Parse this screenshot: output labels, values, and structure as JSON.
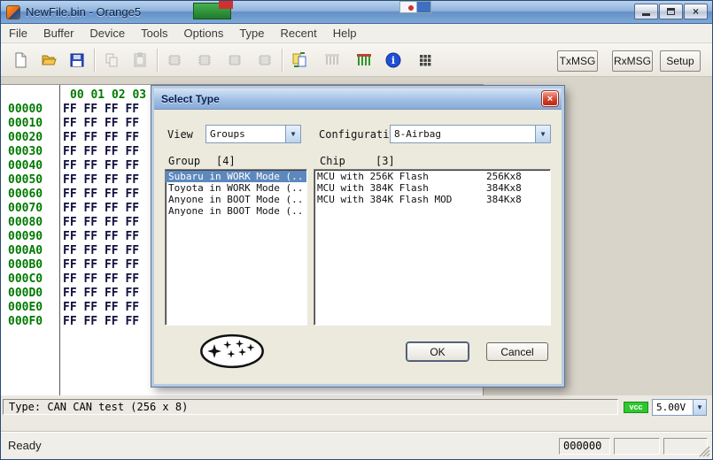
{
  "window": {
    "title": "NewFile.bin - Orange5"
  },
  "icons": {
    "close_glyph": "×",
    "dropdown_glyph": "▼"
  },
  "menu": {
    "items": [
      "File",
      "Buffer",
      "Device",
      "Tools",
      "Options",
      "Type",
      "Recent",
      "Help"
    ]
  },
  "toolbar": {
    "icon_buttons": [
      "new-file",
      "open-file",
      "save-file",
      "copy",
      "paste",
      "chip-1",
      "chip-2",
      "chip-3",
      "chip-4",
      "compare-buffers",
      "connector-inactive",
      "connector-active",
      "info",
      "keypad"
    ],
    "txmsg_label": "TxMSG",
    "rxmsg_label": "RxMSG",
    "setup_label": "Setup"
  },
  "hex": {
    "col_header": "00 01 02 03",
    "rows": [
      {
        "addr": "00000",
        "bytes": "FF FF FF FF"
      },
      {
        "addr": "00010",
        "bytes": "FF FF FF FF"
      },
      {
        "addr": "00020",
        "bytes": "FF FF FF FF"
      },
      {
        "addr": "00030",
        "bytes": "FF FF FF FF"
      },
      {
        "addr": "00040",
        "bytes": "FF FF FF FF"
      },
      {
        "addr": "00050",
        "bytes": "FF FF FF FF"
      },
      {
        "addr": "00060",
        "bytes": "FF FF FF FF"
      },
      {
        "addr": "00070",
        "bytes": "FF FF FF FF"
      },
      {
        "addr": "00080",
        "bytes": "FF FF FF FF"
      },
      {
        "addr": "00090",
        "bytes": "FF FF FF FF"
      },
      {
        "addr": "000A0",
        "bytes": "FF FF FF FF"
      },
      {
        "addr": "000B0",
        "bytes": "FF FF FF FF"
      },
      {
        "addr": "000C0",
        "bytes": "FF FF FF FF"
      },
      {
        "addr": "000D0",
        "bytes": "FF FF FF FF"
      },
      {
        "addr": "000E0",
        "bytes": "FF FF FF FF"
      },
      {
        "addr": "000F0",
        "bytes": "FF FF FF FF"
      }
    ]
  },
  "dialog": {
    "title": "Select Type",
    "view_label": "View",
    "view_value": "Groups",
    "config_label": "Configuratio",
    "config_value": "8-Airbag",
    "group_label": "Group",
    "group_count": "[4]",
    "chip_label": "Chip",
    "chip_count": "[3]",
    "groups": [
      "Subaru in WORK Mode (..",
      "Toyota in WORK Mode (..",
      "Anyone in BOOT Mode (..",
      "Anyone in BOOT Mode (.."
    ],
    "selected_group_index": 0,
    "chips": [
      {
        "name": "MCU with 256K Flash",
        "size": "256Kx8"
      },
      {
        "name": "MCU with 384K Flash",
        "size": "384Kx8"
      },
      {
        "name": "MCU with 384K Flash MOD",
        "size": "384Kx8"
      }
    ],
    "ok_label": "OK",
    "cancel_label": "Cancel"
  },
  "status": {
    "type_text": "Type: CAN CAN test (256 x 8)",
    "vcc_label": "vcc",
    "voltage_value": "5.00V"
  },
  "statusbar": {
    "ready_label": "Ready",
    "counter_value": "000000"
  },
  "colors": {
    "selection_blue": "#5d88bd",
    "vcc_green": "#2ec82e",
    "hex_green": "#007a00",
    "hex_navy": "#10103e"
  }
}
